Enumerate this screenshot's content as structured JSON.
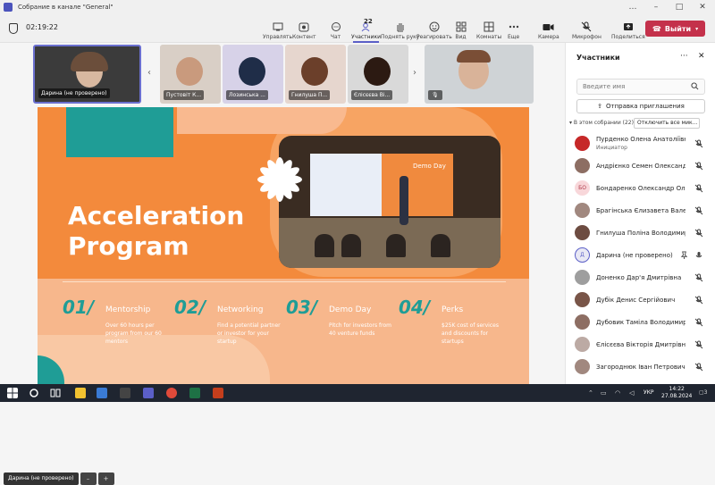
{
  "window": {
    "title": "Собрание в канале \"General\"",
    "controls": [
      "…",
      "–",
      "□",
      "✕"
    ]
  },
  "meeting": {
    "elapsed": "02:19:22"
  },
  "toolbar": {
    "items": [
      {
        "label": "Управлять",
        "icon": "share-screen-icon"
      },
      {
        "label": "Контент",
        "icon": "content-icon"
      },
      {
        "label": "Чат",
        "icon": "chat-icon"
      },
      {
        "label": "Участники",
        "icon": "people-icon",
        "count": "22"
      },
      {
        "label": "Поднять руку",
        "icon": "hand-icon"
      },
      {
        "label": "Реагировать",
        "icon": "smile-icon"
      },
      {
        "label": "Вид",
        "icon": "view-icon"
      },
      {
        "label": "Комнаты",
        "icon": "rooms-icon"
      },
      {
        "label": "Еще",
        "icon": "more-icon"
      },
      {
        "label": "Камера",
        "icon": "camera-icon"
      },
      {
        "label": "Микрофон",
        "icon": "mic-off-icon"
      },
      {
        "label": "Поделиться",
        "icon": "share-icon"
      }
    ],
    "leave_label": "Выйти"
  },
  "tiles": [
    {
      "name": "Дарина (не проверено)"
    },
    {
      "name": "Пустовіт К..."
    },
    {
      "name": "Лозинська ..."
    },
    {
      "name": "Гнилуша П..."
    },
    {
      "name": "Єлісєєва Ві..."
    }
  ],
  "slide": {
    "headline_1": "Acceleration",
    "headline_2": "Program",
    "photo_caption": "Demo Day",
    "features": [
      {
        "num": "01/",
        "title": "Mentorship",
        "desc": "Over 60 hours per program from our 60 mentors"
      },
      {
        "num": "02/",
        "title": "Networking",
        "desc": "Find a potential partner or investor for your startup"
      },
      {
        "num": "03/",
        "title": "Demo Day",
        "desc": "Pitch for investors from 40 venture funds"
      },
      {
        "num": "04/",
        "title": "Perks",
        "desc": "$25K cost of services and discounts for startups"
      }
    ],
    "colors": {
      "orange": "#f38a3c",
      "teal": "#1f9d96",
      "peach": "#f9b98f"
    }
  },
  "presenter_bar": {
    "name": "Дарина (не проверено)",
    "minus": "–",
    "plus": "+"
  },
  "panel": {
    "title": "Участники",
    "search_placeholder": "Введите имя",
    "invite_label": "Отправка приглашения",
    "section_label": "▾ В этом собрании (22)",
    "mute_all_label": "Отключить все мик...",
    "participants": [
      {
        "name": "Пурденко Олена Анатоліївна",
        "role": "Инициатор",
        "av": "#c62828"
      },
      {
        "name": "Андрієнко Семен Олександр...",
        "av": "#8d6e63"
      },
      {
        "name": "Бондаренко Олександр Олег...",
        "initials": "БО",
        "av": "#f8d7da"
      },
      {
        "name": "Брагінська Єлизавета Валент...",
        "av": "#a1887f"
      },
      {
        "name": "Гнилуша Поліна Володимирі...",
        "av": "#6d4c41"
      },
      {
        "name": "Дарина (не проверено)",
        "initials": "Д",
        "av": "#e8e8f4"
      },
      {
        "name": "Доненко Дар'я Дмитрівна",
        "av": "#9e9e9e"
      },
      {
        "name": "Дубік Денис Сергійович",
        "av": "#795548"
      },
      {
        "name": "Дубовик Таміла Володимирі...",
        "av": "#8d6e63"
      },
      {
        "name": "Єлісєєва Вікторія Дмитрівна",
        "av": "#bcaaa4"
      },
      {
        "name": "Загороднюк Іван Петрович",
        "av": "#a1887f"
      }
    ]
  },
  "taskbar": {
    "lang": "УКР",
    "time": "14:22",
    "date": "27.08.2024",
    "badge": "3"
  }
}
